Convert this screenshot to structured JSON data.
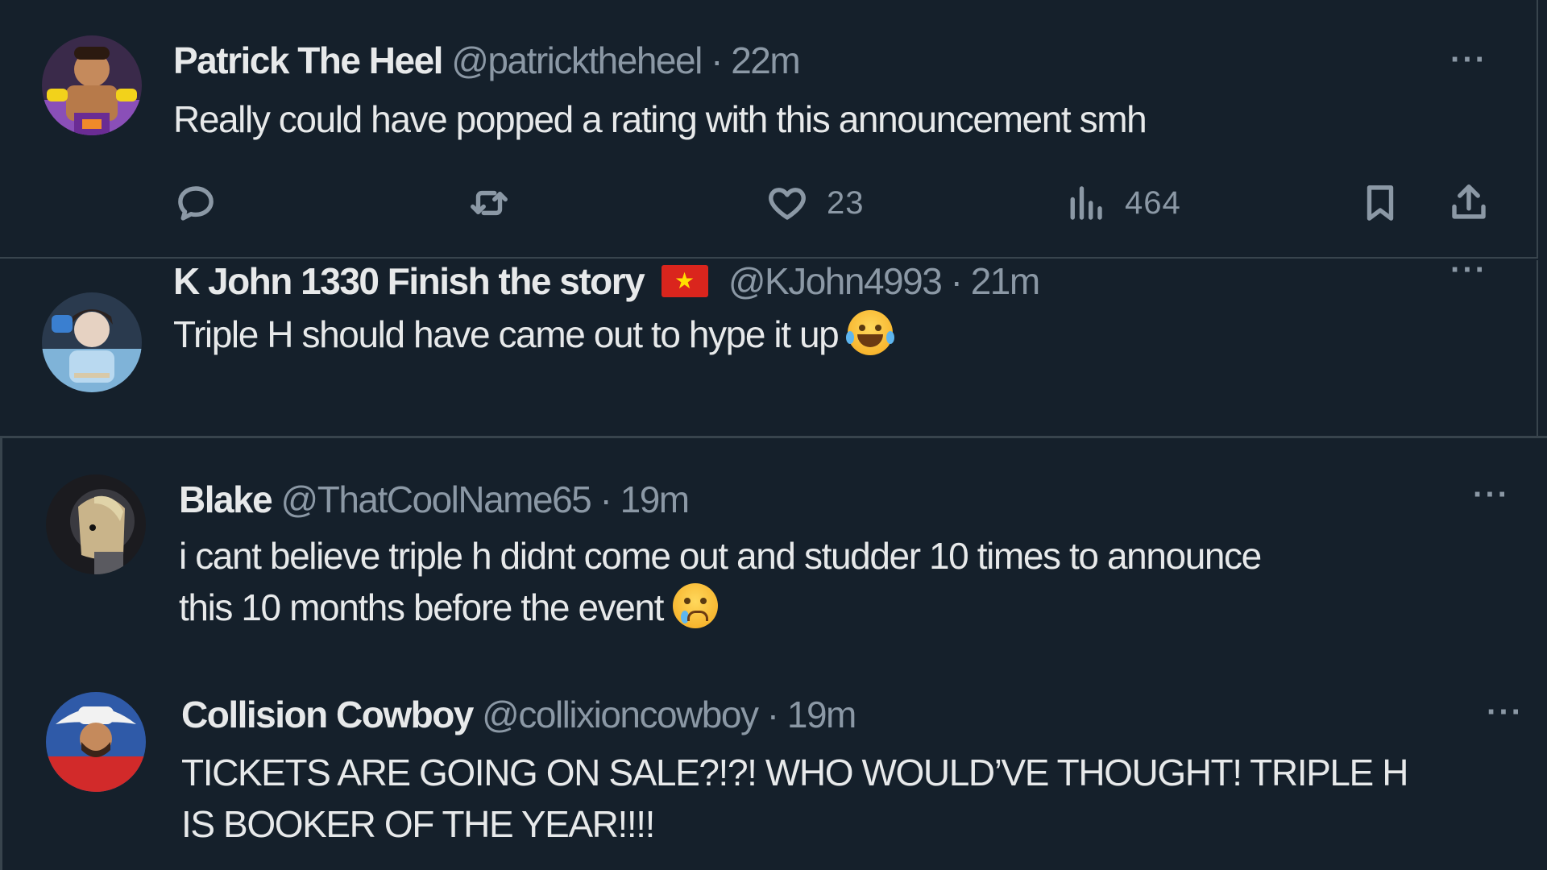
{
  "tweets": [
    {
      "name": "Patrick The Heel",
      "handle": "@patricktheheel",
      "separator": "·",
      "time": "22m",
      "text": "Really could have popped a rating with this announcement smh",
      "more": "···",
      "avatar_icon": "wrestler-avatar",
      "actions": {
        "reply_icon": "reply-icon",
        "retweet_icon": "retweet-icon",
        "like_icon": "heart-icon",
        "like_count": "23",
        "views_icon": "views-chart-icon",
        "views_count": "464",
        "bookmark_icon": "bookmark-icon",
        "share_icon": "share-icon"
      }
    },
    {
      "name": "K John 1330 Finish the story",
      "flag": "vietnam-flag",
      "handle": "@KJohn4993",
      "separator": "·",
      "time": "21m",
      "text": "Triple H should have came out to hype it up",
      "emoji": "face-with-tears-of-joy",
      "more": "···",
      "avatar_icon": "fan-avatar"
    },
    {
      "name": "Blake",
      "handle": "@ThatCoolName65",
      "separator": "·",
      "time": "19m",
      "text_line1": "i cant believe triple h didnt come out and studder 10 times to announce",
      "text_line2": "this 10 months before the event",
      "emoji": "crying-face",
      "more": "···",
      "avatar_icon": "cartoon-avatar"
    },
    {
      "name": "Collision Cowboy",
      "handle": "@collixioncowboy",
      "separator": "·",
      "time": "19m",
      "text_line1": "TICKETS ARE GOING ON SALE?!?! WHO WOULD’VE THOUGHT! TRIPLE H",
      "text_line2": "IS BOOKER OF THE YEAR!!!!",
      "more": "···",
      "avatar_icon": "cowboy-avatar"
    }
  ],
  "colors": {
    "background": "#15202b",
    "divider": "#38444d",
    "text_primary": "#e7e9ea",
    "text_secondary": "#8b98a5"
  }
}
